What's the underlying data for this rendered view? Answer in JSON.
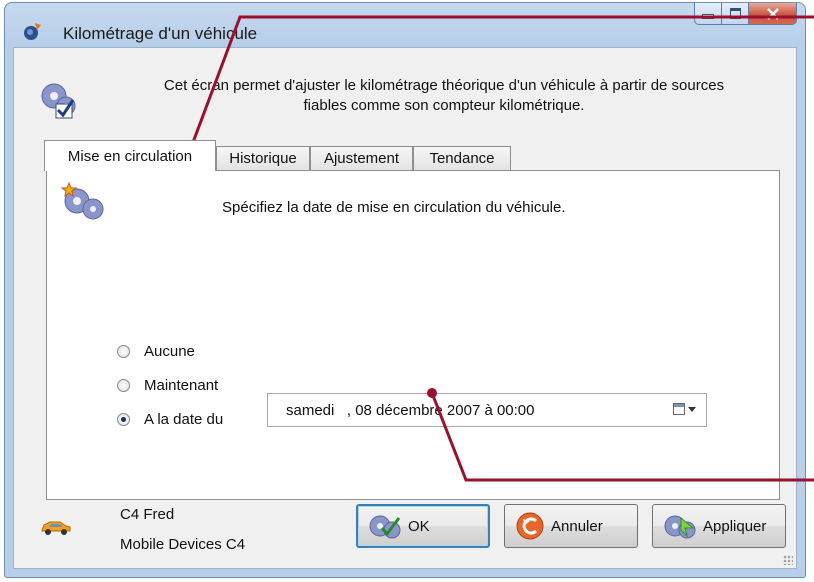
{
  "window": {
    "title": "Kilométrage d'un véhicule"
  },
  "header": {
    "description_line1": "Cet écran permet d'ajuster le kilométrage théorique d'un véhicule à partir de sources",
    "description_line2": "fiables comme son compteur kilométrique."
  },
  "tabs": [
    {
      "label": "Mise en circulation",
      "active": true
    },
    {
      "label": "Historique",
      "active": false
    },
    {
      "label": "Ajustement",
      "active": false
    },
    {
      "label": "Tendance",
      "active": false
    }
  ],
  "panel": {
    "instruction": "Spécifiez la date de mise en circulation du véhicule.",
    "options": [
      {
        "label": "Aucune",
        "checked": false
      },
      {
        "label": "Maintenant",
        "checked": false
      },
      {
        "label": "A la date du",
        "checked": true
      }
    ],
    "date_value": "samedi   , 08 décembre 2007 à 00:00"
  },
  "footer": {
    "vehicle_name": "C4 Fred",
    "vehicle_device": "Mobile Devices C4"
  },
  "buttons": {
    "ok": "OK",
    "cancel": "Annuler",
    "apply": "Appliquer"
  },
  "colors": {
    "annotation": "#9b1030",
    "accent_border": "#3c7fb1"
  },
  "icons": [
    "app-icon",
    "gears-check-icon",
    "gears-star-icon",
    "car-icon",
    "calendar-icon",
    "ok-icon",
    "cancel-icon",
    "apply-icon"
  ]
}
